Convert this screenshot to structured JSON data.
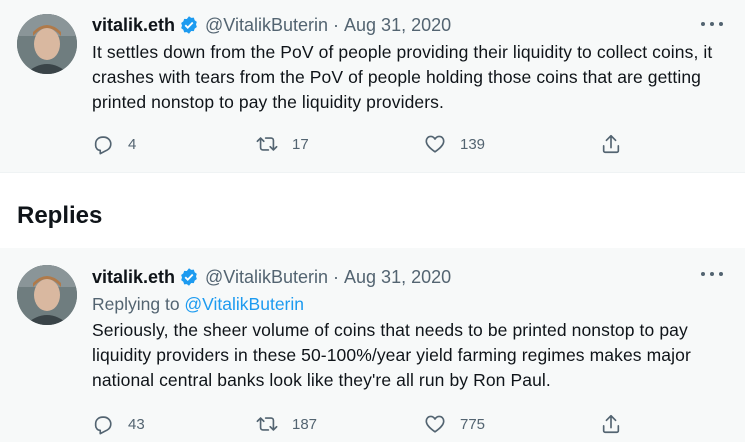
{
  "tweet": {
    "display_name": "vitalik.eth",
    "handle": "@VitalikButerin",
    "separator": "·",
    "date": "Aug 31, 2020",
    "text": "It settles down from the PoV of people providing their liquidity to collect coins, it crashes with tears from the PoV of people holding those coins that are getting printed nonstop to pay the liquidity providers.",
    "actions": {
      "reply_count": "4",
      "retweet_count": "17",
      "like_count": "139"
    }
  },
  "replies_section": {
    "title": "Replies"
  },
  "reply": {
    "display_name": "vitalik.eth",
    "handle": "@VitalikButerin",
    "separator": "·",
    "date": "Aug 31, 2020",
    "replying_to_prefix": "Replying to ",
    "replying_to_handle": "@VitalikButerin",
    "text": "Seriously, the sheer volume of coins that needs to be printed nonstop to pay liquidity providers in these 50-100%/year yield farming regimes makes major national central banks look like they're all run by Ron Paul.",
    "actions": {
      "reply_count": "43",
      "retweet_count": "187",
      "like_count": "775"
    }
  },
  "icons": {
    "verified": "verified-badge-icon",
    "more": "more-dots-icon",
    "reply": "reply-bubble-icon",
    "retweet": "retweet-icon",
    "like": "heart-icon",
    "share": "share-icon"
  },
  "colors": {
    "accent": "#1d9bf0",
    "muted_text": "#536471",
    "tweet_background": "#f7f9f9"
  }
}
